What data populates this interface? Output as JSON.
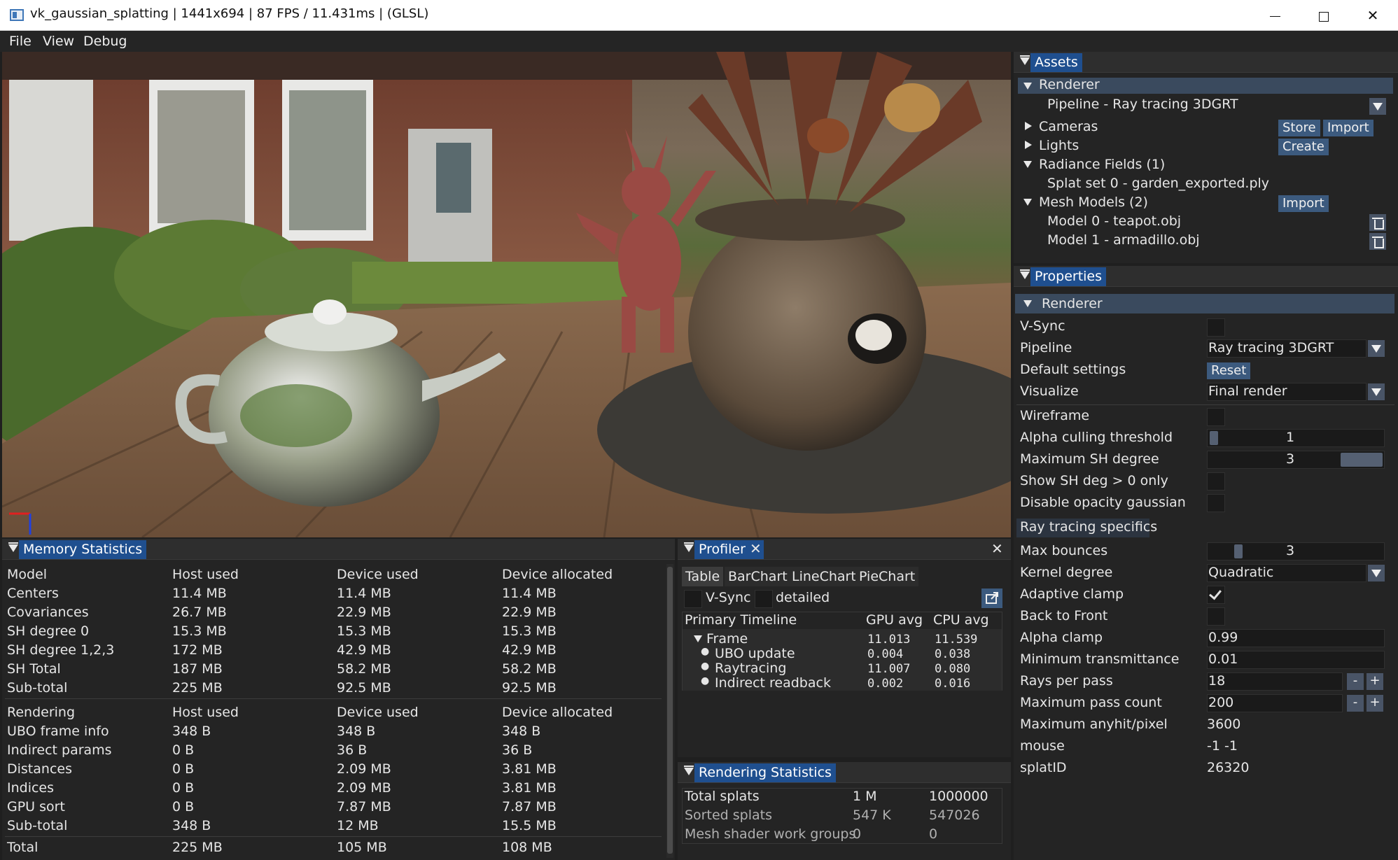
{
  "window": {
    "title": "vk_gaussian_splatting | 1441x694 | 87 FPS / 11.431ms | (GLSL)",
    "minimize_icon": "minimize-icon",
    "maximize_icon": "maximize-icon",
    "close_icon": "close-icon"
  },
  "menu": [
    "File",
    "View",
    "Debug"
  ],
  "assets": {
    "title": "Assets",
    "renderer_label": "Renderer",
    "pipeline_label": "Pipeline - Ray tracing 3DGRT",
    "cameras_label": "Cameras",
    "store_button": "Store",
    "import_button": "Import",
    "lights_label": "Lights",
    "create_button": "Create",
    "radiance_label": "Radiance Fields (1)",
    "splat_label": "Splat set 0 - garden_exported.ply",
    "mesh_label": "Mesh Models (2)",
    "mesh_import_button": "Import",
    "model0": "Model 0 - teapot.obj",
    "model1": "Model 1 - armadillo.obj"
  },
  "properties": {
    "title": "Properties",
    "renderer_header": "Renderer",
    "vsync_label": "V-Sync",
    "pipeline_label": "Pipeline",
    "pipeline_value": "Ray tracing 3DGRT",
    "default_label": "Default settings",
    "reset_button": "Reset",
    "visualize_label": "Visualize",
    "visualize_value": "Final render",
    "wireframe_label": "Wireframe",
    "alpha_cull_label": "Alpha culling threshold",
    "alpha_cull_value": "1",
    "max_sh_label": "Maximum SH degree",
    "max_sh_value": "3",
    "show_sh_label": "Show SH deg > 0 only",
    "disable_opacity_label": "Disable opacity gaussian",
    "rt_header": "Ray tracing specifics",
    "max_bounces_label": "Max bounces",
    "max_bounces_value": "3",
    "kernel_label": "Kernel degree",
    "kernel_value": "Quadratic",
    "adaptive_label": "Adaptive clamp",
    "back_front_label": "Back to Front",
    "alpha_clamp_label": "Alpha clamp",
    "alpha_clamp_value": "0.99",
    "min_trans_label": "Minimum transmittance",
    "min_trans_value": "0.01",
    "rays_label": "Rays per pass",
    "rays_value": "18",
    "max_pass_label": "Maximum pass count",
    "max_pass_value": "200",
    "anyhit_label": "Maximum anyhit/pixel",
    "anyhit_value": "3600",
    "mouse_label": "mouse",
    "mouse_value": "-1 -1",
    "splat_label": "splatID",
    "splat_value": "26320",
    "minus": "-",
    "plus": "+"
  },
  "memory": {
    "title": "Memory Statistics",
    "model_headers": [
      "Model",
      "Host used",
      "Device used",
      "Device allocated"
    ],
    "model_rows": [
      [
        "Centers",
        "11.4 MB",
        "11.4 MB",
        "11.4 MB"
      ],
      [
        "Covariances",
        "26.7 MB",
        "22.9 MB",
        "22.9 MB"
      ],
      [
        "SH degree 0",
        "15.3 MB",
        "15.3 MB",
        "15.3 MB"
      ],
      [
        "SH degree 1,2,3",
        "172 MB",
        "42.9 MB",
        "42.9 MB"
      ],
      [
        "SH Total",
        "187 MB",
        "58.2 MB",
        "58.2 MB"
      ],
      [
        "Sub-total",
        "225 MB",
        "92.5 MB",
        "92.5 MB"
      ]
    ],
    "render_headers": [
      "Rendering",
      "Host used",
      "Device used",
      "Device allocated"
    ],
    "render_rows": [
      [
        "UBO frame info",
        "348 B",
        "348 B",
        "348 B"
      ],
      [
        "Indirect params",
        "0 B",
        "36 B",
        "36 B"
      ],
      [
        "Distances",
        "0 B",
        "2.09 MB",
        "3.81 MB"
      ],
      [
        "Indices",
        "0 B",
        "2.09 MB",
        "3.81 MB"
      ],
      [
        "GPU sort",
        "0 B",
        "7.87 MB",
        "7.87 MB"
      ],
      [
        "Sub-total",
        "348 B",
        "12 MB",
        "15.5 MB"
      ]
    ],
    "total_row": [
      "Total",
      "225 MB",
      "105 MB",
      "108 MB"
    ]
  },
  "profiler": {
    "title": "Profiler",
    "tabs": [
      "Table",
      "BarChart",
      "LineChart",
      "PieChart"
    ],
    "vsync_label": "V-Sync",
    "detailed_label": "detailed",
    "headers": [
      "Primary Timeline",
      "GPU avg",
      "CPU avg"
    ],
    "rows": [
      [
        "Frame",
        "11.013",
        "11.539"
      ],
      [
        "UBO update",
        "0.004",
        "0.038"
      ],
      [
        "Raytracing",
        "11.007",
        "0.080"
      ],
      [
        "Indirect readback",
        "0.002",
        "0.016"
      ]
    ]
  },
  "rstats": {
    "title": "Rendering Statistics",
    "rows": [
      [
        "Total splats",
        "1 M",
        "1000000"
      ],
      [
        "Sorted splats",
        "547 K",
        "547026"
      ],
      [
        "Mesh shader work groups",
        "0",
        "0"
      ]
    ]
  }
}
